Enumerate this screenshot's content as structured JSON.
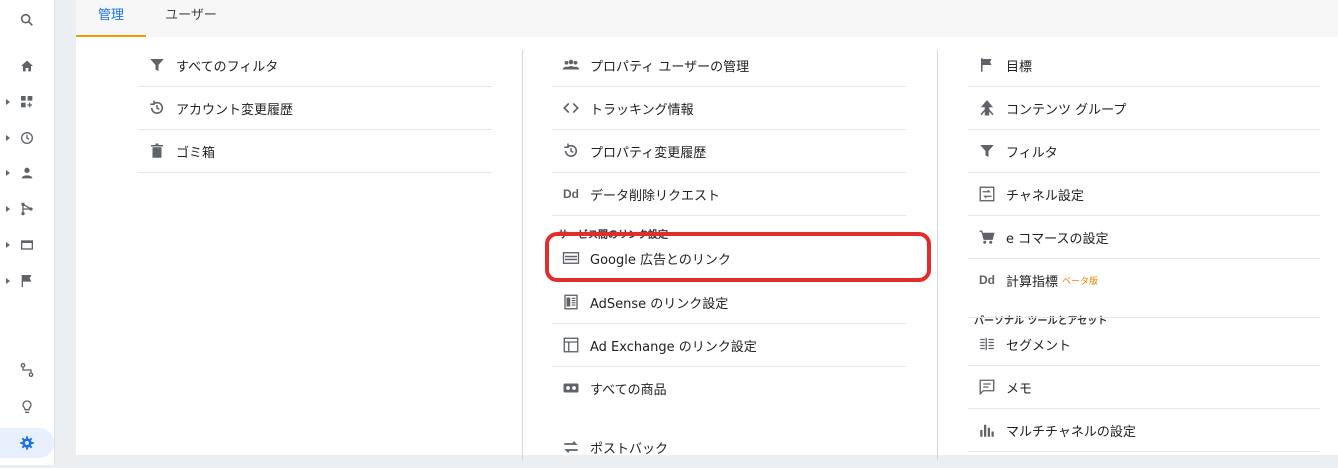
{
  "tabs": {
    "admin": "管理",
    "user": "ユーザー"
  },
  "account_column": {
    "items": [
      {
        "label": "すべてのフィルタ",
        "icon": "filter-icon"
      },
      {
        "label": "アカウント変更履歴",
        "icon": "history-icon"
      },
      {
        "label": "ゴミ箱",
        "icon": "trash-icon"
      }
    ]
  },
  "property_column": {
    "items": [
      {
        "label": "プロパティ ユーザーの管理",
        "icon": "people-icon"
      },
      {
        "label": "トラッキング情報",
        "icon": "code-icon"
      },
      {
        "label": "プロパティ変更履歴",
        "icon": "history-icon"
      },
      {
        "label": "データ削除リクエスト",
        "icon": "dd-icon",
        "glyph": "Dd"
      }
    ],
    "links_section": "サービス間のリンク設定",
    "links": [
      {
        "label": "Google 広告とのリンク",
        "icon": "google-ads-icon"
      },
      {
        "label": "AdSense のリンク設定",
        "icon": "adsense-icon"
      },
      {
        "label": "Ad Exchange のリンク設定",
        "icon": "ad-exchange-icon"
      },
      {
        "label": "すべての商品",
        "icon": "products-icon"
      },
      {
        "label": "ポストバック",
        "icon": "postback-icon"
      }
    ]
  },
  "view_column": {
    "items": [
      {
        "label": "目標",
        "icon": "flag-icon"
      },
      {
        "label": "コンテンツ グループ",
        "icon": "content-group-icon"
      },
      {
        "label": "フィルタ",
        "icon": "filter-icon"
      },
      {
        "label": "チャネル設定",
        "icon": "channel-icon"
      },
      {
        "label": "e コマースの設定",
        "icon": "cart-icon"
      },
      {
        "label": "計算指標",
        "icon": "dd-icon",
        "glyph": "Dd",
        "badge": "ベータ版"
      }
    ],
    "tools_section": "パーソナル ツールとアセット",
    "tools": [
      {
        "label": "セグメント",
        "icon": "segment-icon"
      },
      {
        "label": "メモ",
        "icon": "memo-icon"
      },
      {
        "label": "マルチチャネルの設定",
        "icon": "bar-chart-icon"
      }
    ]
  },
  "colors": {
    "accent": "#1a73e8",
    "tab_underline": "#f29900",
    "highlight": "#e32d2d",
    "beta": "#f57c00"
  }
}
